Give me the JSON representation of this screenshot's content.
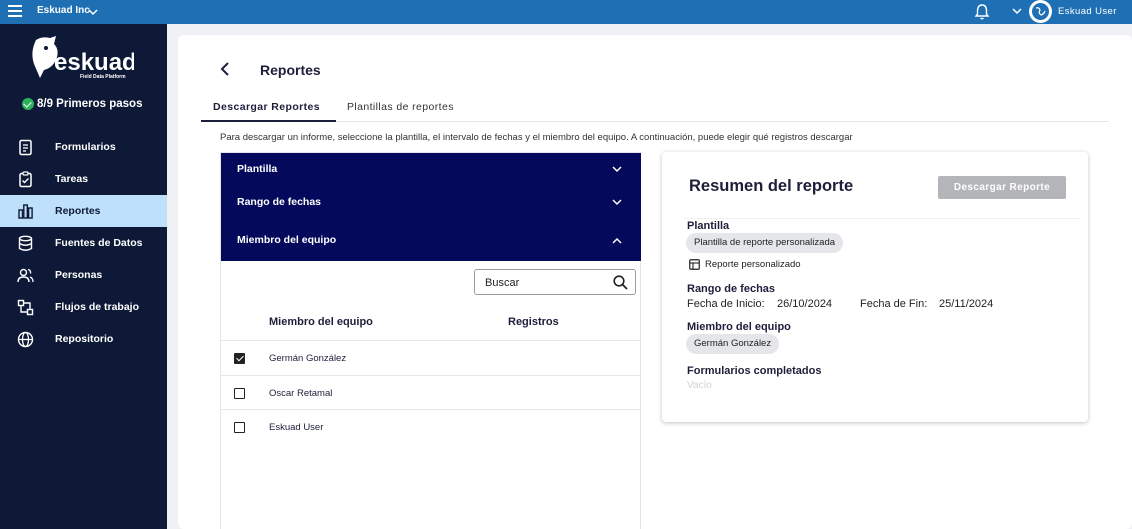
{
  "topbar": {
    "org": "Eskuad Inc",
    "user": "Eskuad User"
  },
  "sidebar": {
    "logo_text": "eskuad",
    "logo_sub": "Field Data Platform",
    "progress": "8/9 Primeros pasos",
    "items": [
      {
        "label": "Formularios",
        "icon": "document-icon"
      },
      {
        "label": "Tareas",
        "icon": "clipboard-check-icon"
      },
      {
        "label": "Reportes",
        "icon": "bar-chart-icon",
        "active": true
      },
      {
        "label": "Fuentes de Datos",
        "icon": "database-icon"
      },
      {
        "label": "Personas",
        "icon": "people-icon"
      },
      {
        "label": "Flujos de trabajo",
        "icon": "workflow-icon"
      },
      {
        "label": "Repositorio",
        "icon": "globe-icon"
      }
    ]
  },
  "page": {
    "title": "Reportes",
    "tabs": [
      "Descargar Reportes",
      "Plantillas de reportes"
    ],
    "description": "Para descargar un informe, seleccione la plantilla, el intervalo de fechas y el miembro del equipo. A continuación, puede elegir qué registros descargar"
  },
  "accordion": {
    "plantilla": "Plantilla",
    "rango": "Rango de fechas",
    "miembro": "Miembro del equipo"
  },
  "search": {
    "placeholder": "Buscar"
  },
  "table": {
    "columns": [
      "Miembro del equipo",
      "Registros"
    ],
    "rows": [
      {
        "name": "Germán González",
        "checked": true
      },
      {
        "name": "Oscar Retamal",
        "checked": false
      },
      {
        "name": "Eskuad User",
        "checked": false
      }
    ]
  },
  "summary": {
    "title": "Resumen del reporte",
    "download_button": "Descargar Reporte",
    "template_label": "Plantilla",
    "template_chip": "Plantilla de reporte personalizada",
    "template_type": "Reporte personalizado",
    "range_label": "Rango de fechas",
    "start_label": "Fecha de Inicio:",
    "start_value": "26/10/2024",
    "end_label": "Fecha de Fin:",
    "end_value": "25/11/2024",
    "member_label": "Miembro del equipo",
    "member_chip": "Germán González",
    "forms_label": "Formularios completados",
    "forms_empty": "Vacío"
  },
  "colors": {
    "topbar": "#1f6fb5",
    "sidebar": "#0d1936",
    "active_nav": "#bfe0fb",
    "accordion": "#05095b",
    "button_disabled": "#b3b5b9"
  }
}
